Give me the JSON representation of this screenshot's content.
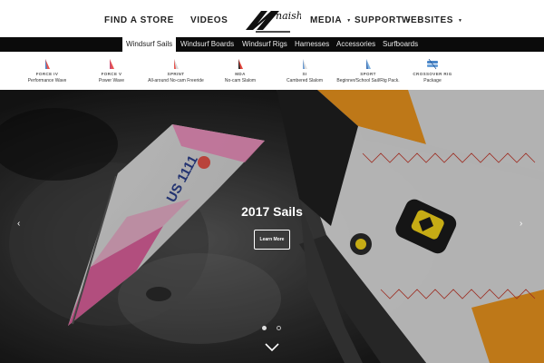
{
  "nav": {
    "find_store": "FIND A STORE",
    "videos": "VIDEOS",
    "media": "MEDIA",
    "support": "SUPPORT",
    "websites": "WEBSITES",
    "brand": "naish"
  },
  "categories": [
    {
      "label": "Windsurf Sails",
      "active": true
    },
    {
      "label": "Windsurf Boards"
    },
    {
      "label": "Windsurf Rigs"
    },
    {
      "label": "Harnesses"
    },
    {
      "label": "Accessories"
    },
    {
      "label": "Surfboards"
    }
  ],
  "products": [
    {
      "name": "FORCE IV",
      "desc": "Performance Wave"
    },
    {
      "name": "FORCE V",
      "desc": "Power Wave"
    },
    {
      "name": "SPRINT",
      "desc": "All-around No-cam Freeride"
    },
    {
      "name": "MDA",
      "desc": "No-cam Slalom"
    },
    {
      "name": "SI",
      "desc": "Cambered Slalom"
    },
    {
      "name": "SPORT",
      "desc": "Beginner/School Sail/Rig Pack."
    },
    {
      "name": "CROSSOVER RIG",
      "desc": "Package"
    }
  ],
  "hero": {
    "title": "2017 Sails",
    "button": "Learn More",
    "sail_text": "US 1111"
  },
  "colors": {
    "black_bar": "#0b0b0b",
    "accent_orange": "#e8931e",
    "accent_yellow": "#f2d21a"
  },
  "icons": {
    "prev": "chevron-left-icon",
    "next": "chevron-right-icon",
    "scroll": "chevron-down-icon"
  }
}
